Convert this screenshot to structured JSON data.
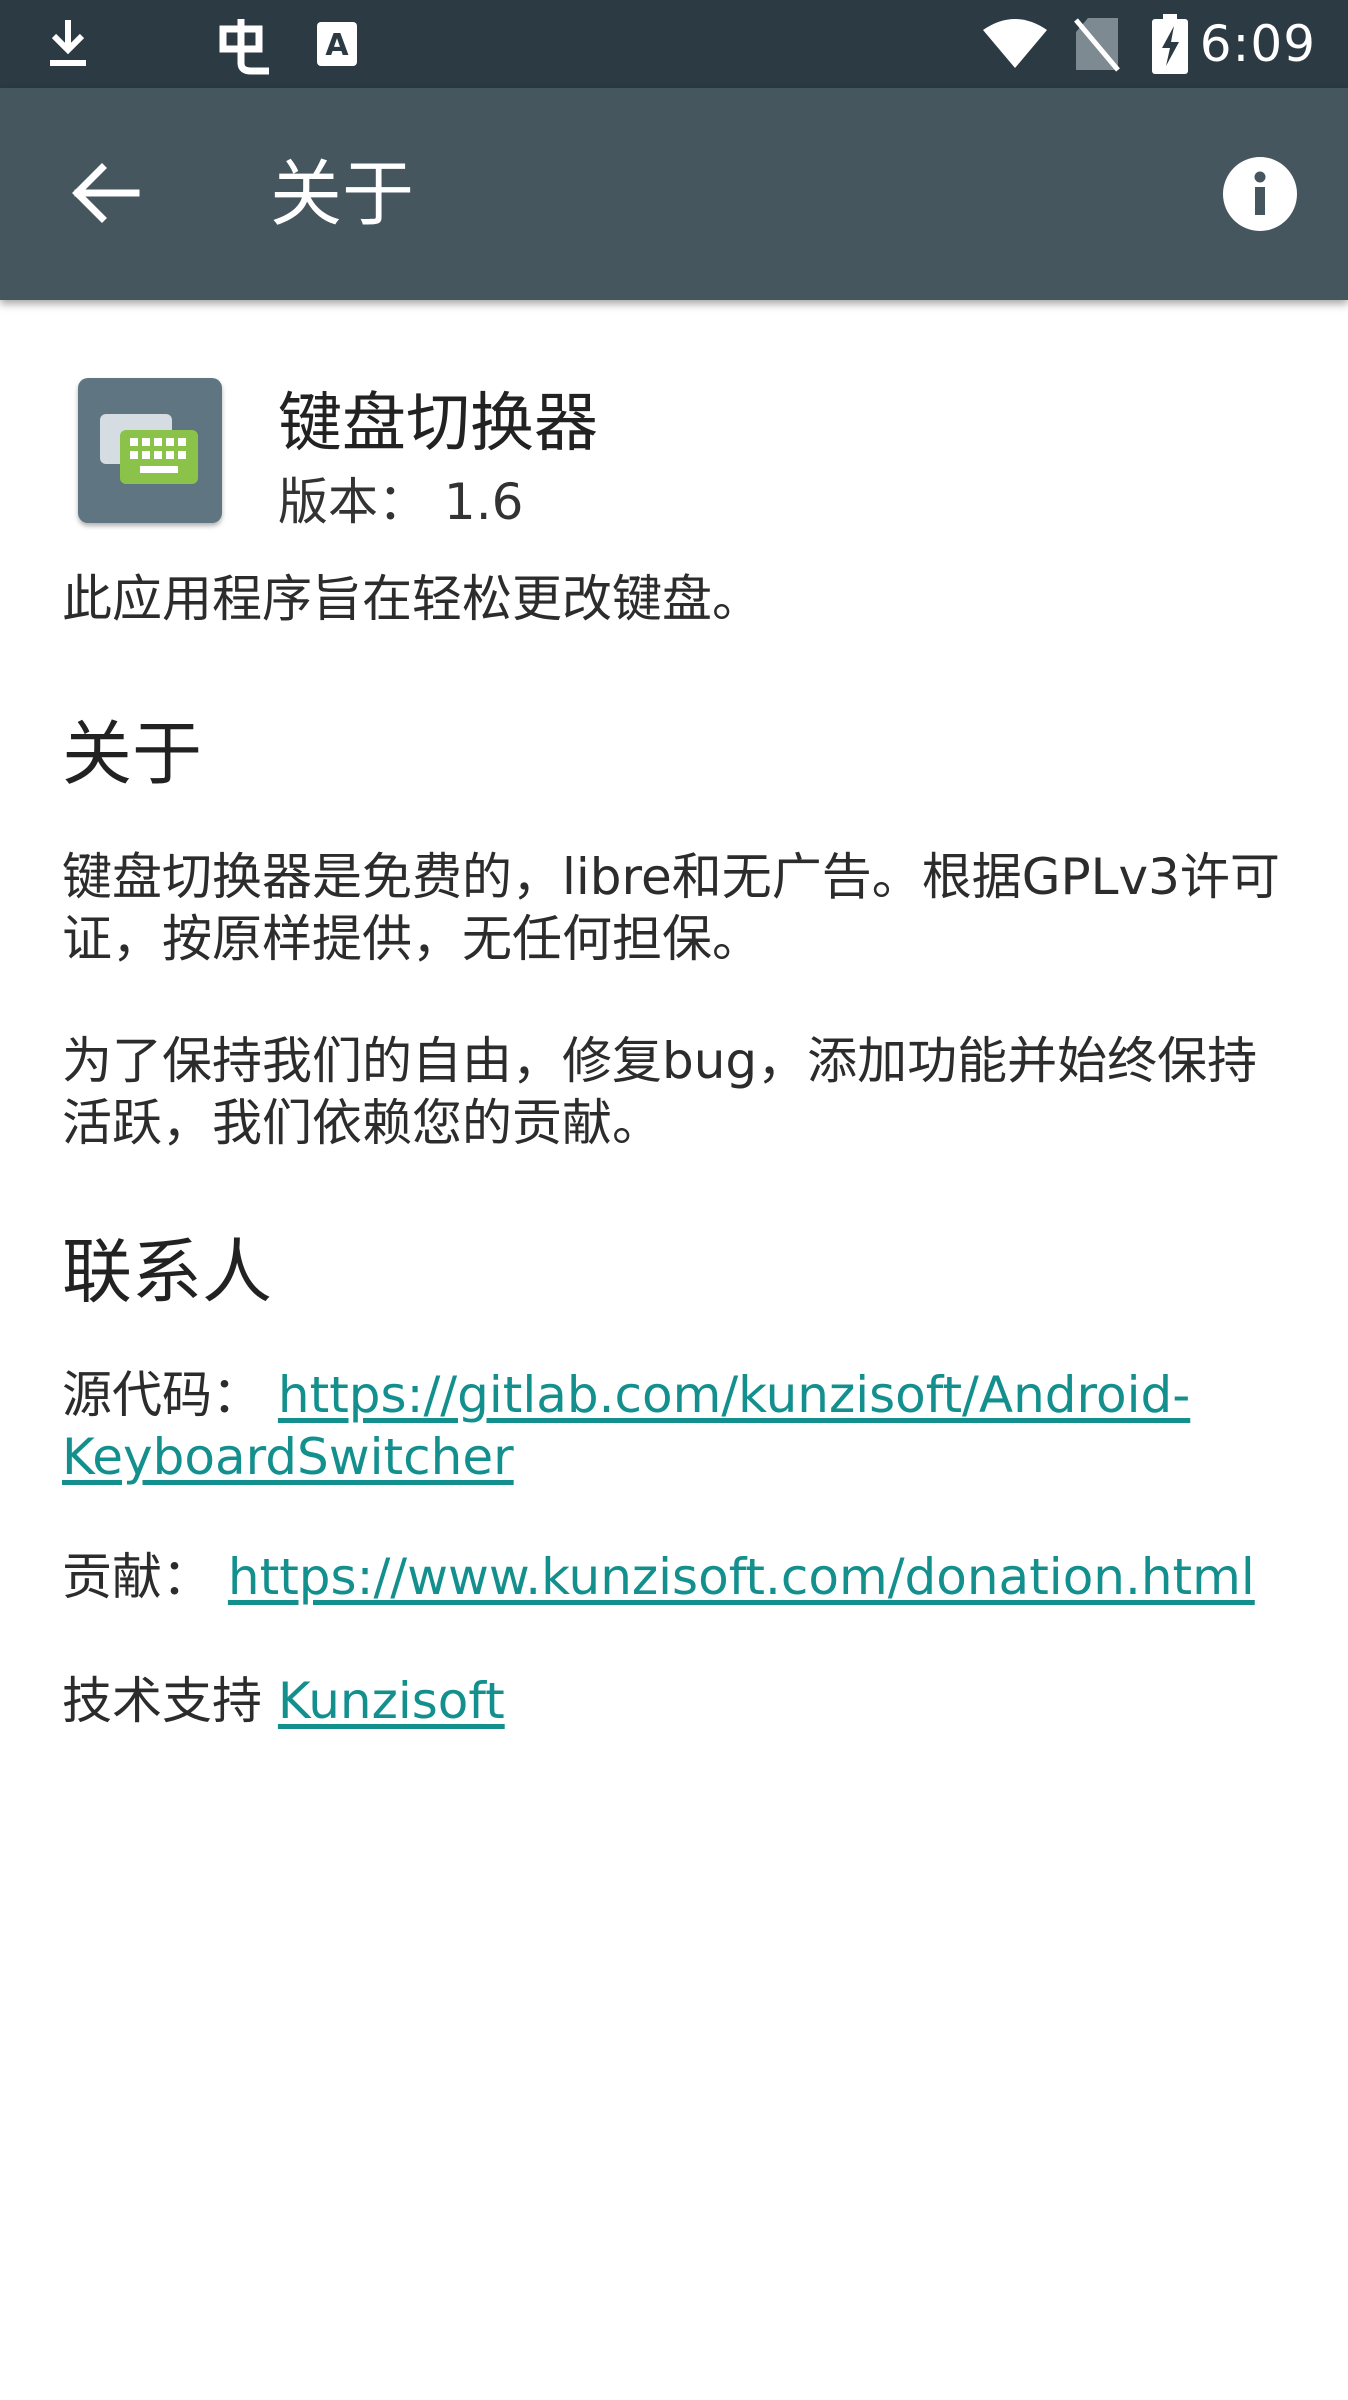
{
  "status_bar": {
    "time": "6:09",
    "icons": [
      "download-icon",
      "app-notification-icon",
      "keyboard-a-icon",
      "wifi-icon",
      "no-sim-icon",
      "battery-charging-icon"
    ]
  },
  "app_bar": {
    "title": "关于",
    "back_icon": "arrow-back-icon",
    "info_icon": "info-icon"
  },
  "header": {
    "app_name": "键盘切换器",
    "version": "版本： 1.6"
  },
  "body": {
    "description": "此应用程序旨在轻松更改键盘。",
    "about_heading": "关于",
    "about_text_1": "键盘切换器是免费的，libre和无广告。根据GPLv3许可证，按原样提供，无任何担保。",
    "about_text_2": "为了保持我们的自由，修复bug，添加功能并始终保持活跃，我们依赖您的贡献。",
    "contact_heading": "联系人",
    "source_label": "源代码：",
    "source_link": "https://gitlab.com/kunzisoft/Android-KeyboardSwitcher",
    "donate_label": "贡献：",
    "donate_link": "https://www.kunzisoft.com/donation.html",
    "support_label": "技术支持",
    "support_link": "Kunzisoft"
  },
  "colors": {
    "status_bar": "#2c3a43",
    "app_bar": "#46565f",
    "link": "#13908e",
    "keyboard_icon_green": "#8bc34a"
  }
}
